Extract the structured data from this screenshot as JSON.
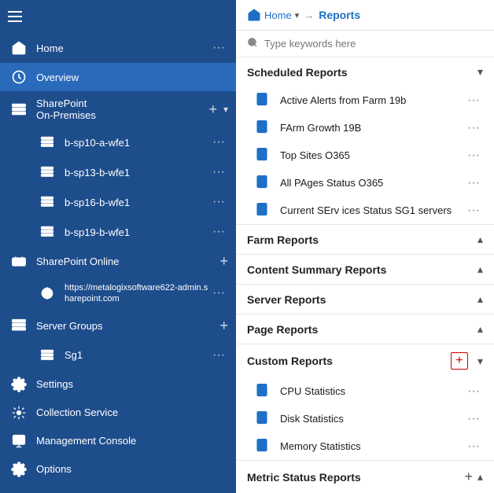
{
  "sidebar": {
    "nav_items": [
      {
        "id": "home",
        "label": "Home",
        "icon": "home",
        "active": false,
        "has_more": true
      },
      {
        "id": "overview",
        "label": "Overview",
        "icon": "overview",
        "active": true,
        "has_more": false
      },
      {
        "id": "sharepoint-on-premises",
        "label": "SharePoint\nOn-Premises",
        "icon": "sp-onprem",
        "active": false,
        "has_more": false,
        "has_add": true,
        "has_chevron": true
      }
    ],
    "sp_sub_items": [
      {
        "id": "b-sp10-a-wfe1",
        "label": "b-sp10-a-wfe1",
        "icon": "server"
      },
      {
        "id": "b-sp13-b-wfe1",
        "label": "b-sp13-b-wfe1",
        "icon": "server"
      },
      {
        "id": "b-sp16-b-wfe1",
        "label": "b-sp16-b-wfe1",
        "icon": "server"
      },
      {
        "id": "b-sp19-b-wfe1",
        "label": "b-sp19-b-wfe1",
        "icon": "server"
      }
    ],
    "sharepoint_online": {
      "label": "SharePoint Online",
      "icon": "sp-online",
      "has_add": true
    },
    "sp_online_url": {
      "label": "https://metalogixsoftware622-admin.sharepoint.com",
      "icon": "sp-online-sub"
    },
    "server_groups": {
      "label": "Server Groups",
      "icon": "server-groups",
      "has_add": true
    },
    "sg1": {
      "label": "Sg1",
      "icon": "server-group-item"
    },
    "settings": {
      "label": "Settings",
      "icon": "settings"
    },
    "collection_service": {
      "label": "Collection Service",
      "icon": "collection"
    },
    "management_console": {
      "label": "Management Console",
      "icon": "mgmt"
    },
    "options": {
      "label": "Options",
      "icon": "options"
    }
  },
  "breadcrumb": {
    "home_label": "Home",
    "arrow": "→",
    "current": "Reports"
  },
  "search": {
    "placeholder": "Type keywords here"
  },
  "reports": {
    "sections": [
      {
        "id": "scheduled",
        "title": "Scheduled Reports",
        "expanded": true,
        "has_add": false,
        "items": [
          {
            "label": "Active Alerts from Farm 19b"
          },
          {
            "label": "FArm Growth 19B"
          },
          {
            "label": "Top Sites O365"
          },
          {
            "label": "All PAges Status O365"
          },
          {
            "label": "Current SErv ices Status SG1 servers"
          }
        ]
      },
      {
        "id": "farm",
        "title": "Farm Reports",
        "expanded": false,
        "has_add": false,
        "items": []
      },
      {
        "id": "content-summary",
        "title": "Content Summary Reports",
        "expanded": false,
        "has_add": false,
        "items": []
      },
      {
        "id": "server",
        "title": "Server Reports",
        "expanded": false,
        "has_add": false,
        "items": []
      },
      {
        "id": "page",
        "title": "Page Reports",
        "expanded": false,
        "has_add": false,
        "items": []
      },
      {
        "id": "custom",
        "title": "Custom Reports",
        "expanded": true,
        "has_add": true,
        "items": [
          {
            "label": "CPU Statistics"
          },
          {
            "label": "Disk Statistics"
          },
          {
            "label": "Memory Statistics"
          }
        ]
      },
      {
        "id": "metric-status",
        "title": "Metric Status Reports",
        "expanded": false,
        "has_add": true,
        "items": []
      }
    ]
  }
}
